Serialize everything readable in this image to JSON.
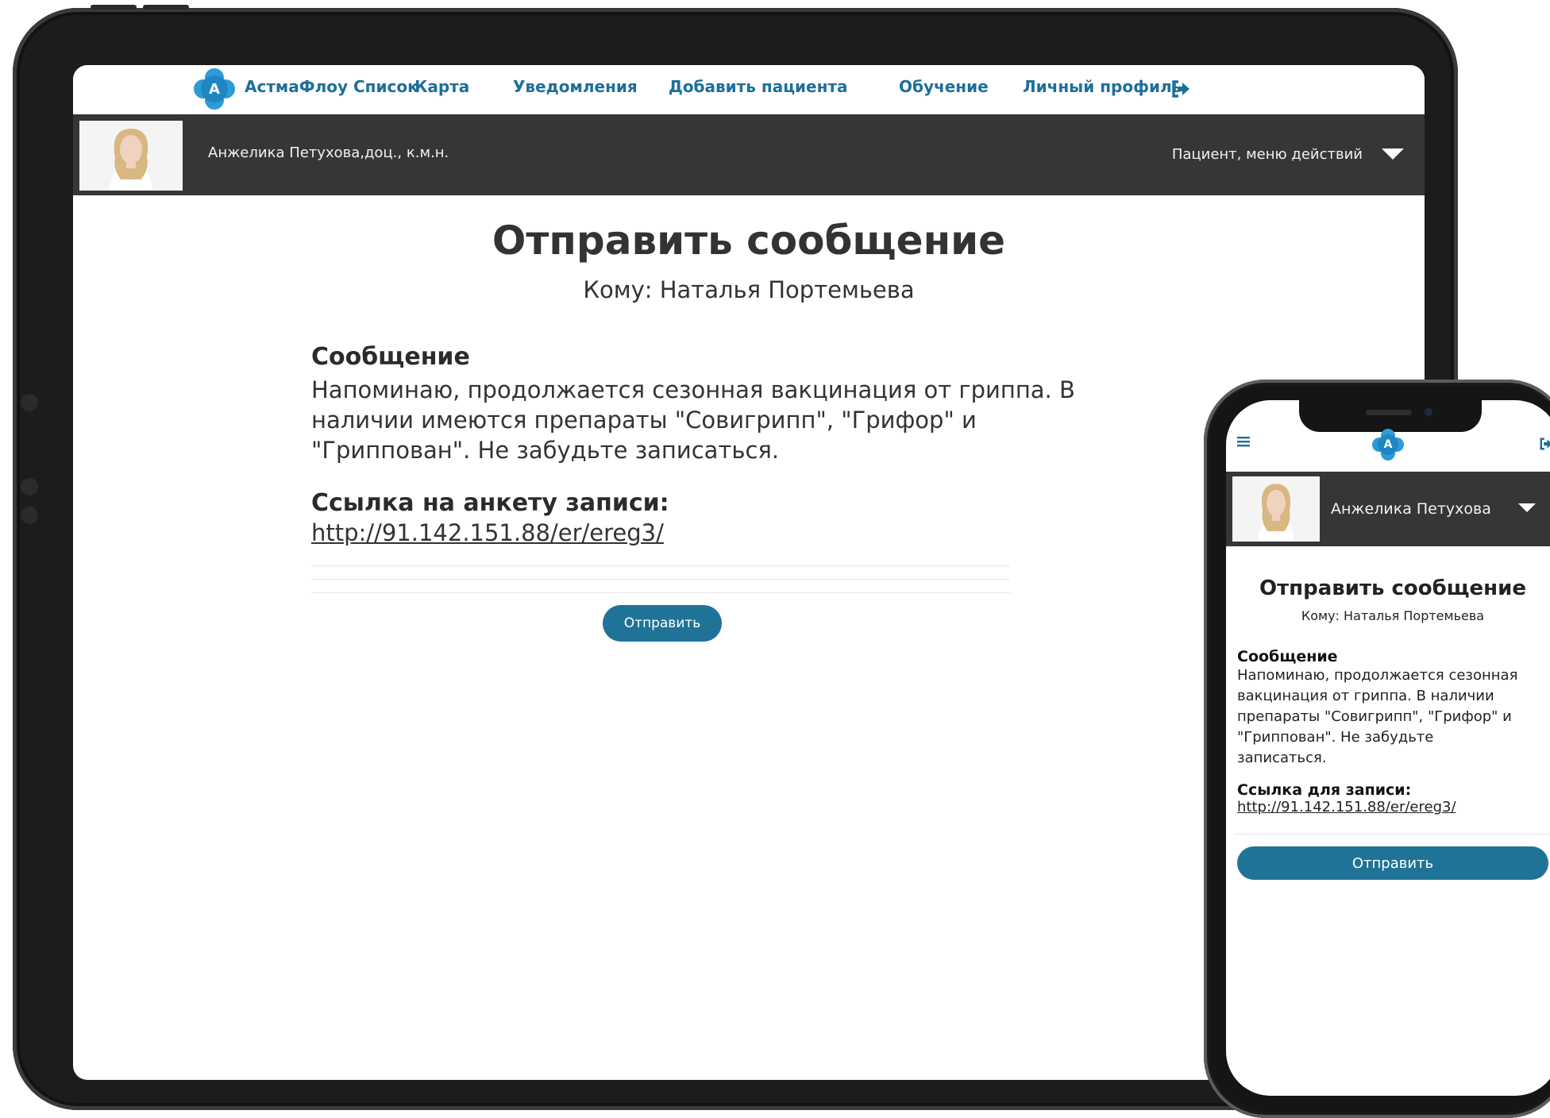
{
  "tablet": {
    "nav": {
      "brand": "АстмаФлоу Список",
      "links": [
        "Карта",
        "Уведомления",
        "Добавить пациента",
        "Обучение",
        "Личный профиль"
      ],
      "logo_letter": "A"
    },
    "userbar": {
      "name": "Анжелика Петухова,доц., к.м.н.",
      "menu_label": "Пациент, меню действий"
    },
    "page": {
      "title": "Отправить сообщение",
      "to": "Кому: Наталья Портемьева",
      "message_heading": "Сообщение",
      "message_lines": [
        "Напоминаю, продолжается сезонная вакцинация от гриппа. В",
        "наличии имеются препараты \"Совигрипп\", \"Грифор\" и",
        "\"Гриппован\". Не забудьте записаться."
      ],
      "link_heading": "Ссылка на анкету записи:",
      "link_url": "http://91.142.151.88/er/ereg3/",
      "send_label": "Отправить"
    }
  },
  "phone": {
    "logo_letter": "A",
    "userbar": {
      "name": "Анжелика Петухова"
    },
    "page": {
      "title": "Отправить сообщение",
      "to": "Кому: Наталья Портемьева",
      "message_heading": "Сообщение",
      "message_lines": [
        "Напоминаю, продолжается сезонная",
        "вакцинация от гриппа. В наличии",
        "препараты \"Совигрипп\", \"Грифор\" и",
        "\"Гриппован\". Не забудьте",
        "записаться."
      ],
      "link_heading": "Ссылка для записи:",
      "link_url": "http://91.142.151.88/er/ereg3/",
      "send_label": "Отправить"
    }
  },
  "colors": {
    "accent": "#1f7397",
    "nav_link": "#1e6f9a",
    "logo": "#2e9bd6",
    "userbar_bg": "#363636"
  },
  "icons": [
    "logo-icon",
    "logout-icon",
    "hamburger-menu-icon",
    "dropdown-caret-icon",
    "avatar"
  ]
}
